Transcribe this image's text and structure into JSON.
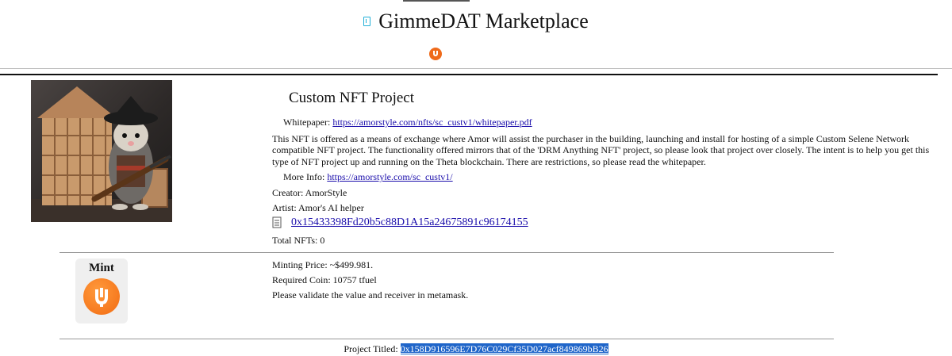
{
  "header": {
    "title": "GimmeDAT Marketplace",
    "logo_icon": "document-icon"
  },
  "project": {
    "title": "Custom NFT Project",
    "whitepaper_label": "Whitepaper:",
    "whitepaper_url": "https://amorstyle.com/nfts/sc_custv1/whitepaper.pdf",
    "description": "This NFT is offered as a means of exchange where Amor will assist the purchaser in the building, launching and install for hosting of a simple Custom Selene Network compatible NFT project. The functionality offered mirrors that of the 'DRM Anything NFT' project, so please look that project over closely. The intent is to help you get this type of NFT project up and running on the Theta blockchain. There are restrictions, so please read the whitepaper.",
    "more_info_label": "More Info:",
    "more_info_url": "https://amorstyle.com/sc_custv1/",
    "creator": "Creator: AmorStyle",
    "artist": "Artist: Amor's AI helper",
    "contract_address": "0x15433398Fd20b5c88D1A15a24675891c96174155",
    "total_nfts": "Total NFTs: 0"
  },
  "mint": {
    "button_label": "Mint",
    "price": "Minting Price: ~$499.981.",
    "required_coin": "Required Coin: 10757 tfuel",
    "notice": "Please validate the value and receiver in metamask."
  },
  "footer": {
    "label": "Project Titled:",
    "address": "0x158D916596E7D76C029Cf35D027acf849869bB26"
  },
  "colors": {
    "accent": "#ef6a1a",
    "link": "#1a0dab",
    "highlight": "#1f65c9"
  }
}
